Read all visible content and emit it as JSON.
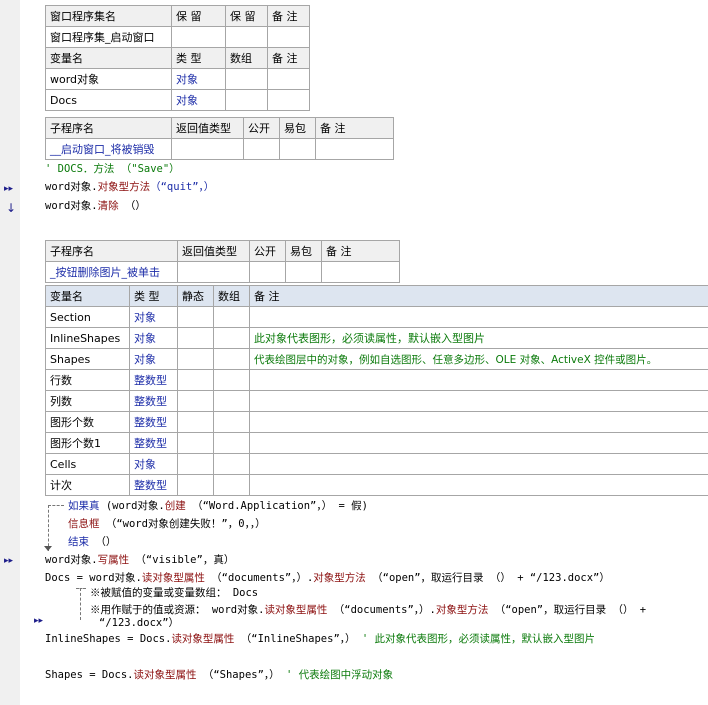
{
  "window_table": {
    "headers": [
      "窗口程序集名",
      "保 留",
      "保 留",
      "备 注"
    ],
    "row": [
      "窗口程序集_启动窗口",
      "",
      "",
      ""
    ]
  },
  "var_table_1": {
    "headers": [
      "变量名",
      "类 型",
      "数组",
      "备 注"
    ],
    "rows": [
      [
        "word对象",
        "对象",
        "",
        ""
      ],
      [
        "Docs",
        "对象",
        "",
        ""
      ]
    ]
  },
  "sub1_table": {
    "headers": [
      "子程序名",
      "返回值类型",
      "公开",
      "易包",
      "备 注"
    ],
    "row": [
      "__启动窗口_将被销毁",
      "",
      "",
      "",
      ""
    ]
  },
  "code1": {
    "line1": "' DOCS．方法 （\"Save\"）",
    "line2": [
      "word对象.",
      "对象型方法",
      "（“quit”，）"
    ],
    "line3": [
      "word对象.",
      "清除",
      " （）"
    ]
  },
  "sub2_table": {
    "headers": [
      "子程序名",
      "返回值类型",
      "公开",
      "易包",
      "备 注"
    ],
    "row": [
      "_按钮删除图片_被单击",
      "",
      "",
      "",
      ""
    ]
  },
  "var_table_2": {
    "headers": [
      "变量名",
      "类 型",
      "静态",
      "数组",
      "备 注"
    ],
    "rows": [
      [
        "Section",
        "对象",
        "",
        "",
        ""
      ],
      [
        "InlineShapes",
        "对象",
        "",
        "",
        "此对象代表图形，必须读属性，默认嵌入型图片"
      ],
      [
        "Shapes",
        "对象",
        "",
        "",
        "代表绘图层中的对象，例如自选图形、任意多边形、OLE 对象、ActiveX 控件或图片。"
      ],
      [
        "行数",
        "整数型",
        "",
        "",
        ""
      ],
      [
        "列数",
        "整数型",
        "",
        "",
        ""
      ],
      [
        "图形个数",
        "整数型",
        "",
        "",
        ""
      ],
      [
        "图形个数1",
        "整数型",
        "",
        "",
        ""
      ],
      [
        "Cells",
        "对象",
        "",
        "",
        ""
      ],
      [
        "计次",
        "整数型",
        "",
        "",
        ""
      ]
    ]
  },
  "code2": {
    "if_line": [
      "如果真",
      " (word对象.",
      "创建",
      " （“Word.Application”，） = 假)"
    ],
    "msg_line": [
      "信息框",
      " （“word对象创建失败！”，0，，）"
    ],
    "end_line": [
      "结束",
      " （）"
    ],
    "write_line": [
      "word对象.",
      "写属性",
      " （“visible”，真）"
    ],
    "docs_line": [
      "Docs = word对象.",
      "读对象型属性",
      " （“documents”，）.",
      "对象型方法",
      " （“open”，取运行目录 （） + “/123.docx”）"
    ],
    "note1": "※被赋值的变量或变量数组： Docs",
    "note2a": "※用作赋于的值或资源： word对象.",
    "note2b": "读对象型属性",
    "note2c": " （“documents”，）.",
    "note2d": "对象型方法",
    "note2e": " （“open”，取运行目录 （） +",
    "note2f": "“/123.docx”）",
    "inline_line": [
      "InlineShapes = Docs.",
      "读对象型属性",
      " （“InlineShapes”，）",
      " ' 此对象代表图形，必须读属性，默认嵌入型图片"
    ],
    "shapes_line": [
      "Shapes = Docs.",
      "读对象型属性",
      " （“Shapes”，）",
      " ' 代表绘图中浮动对象"
    ]
  },
  "markers": {
    "step": "▸▸",
    "down_arrow": "↓"
  }
}
